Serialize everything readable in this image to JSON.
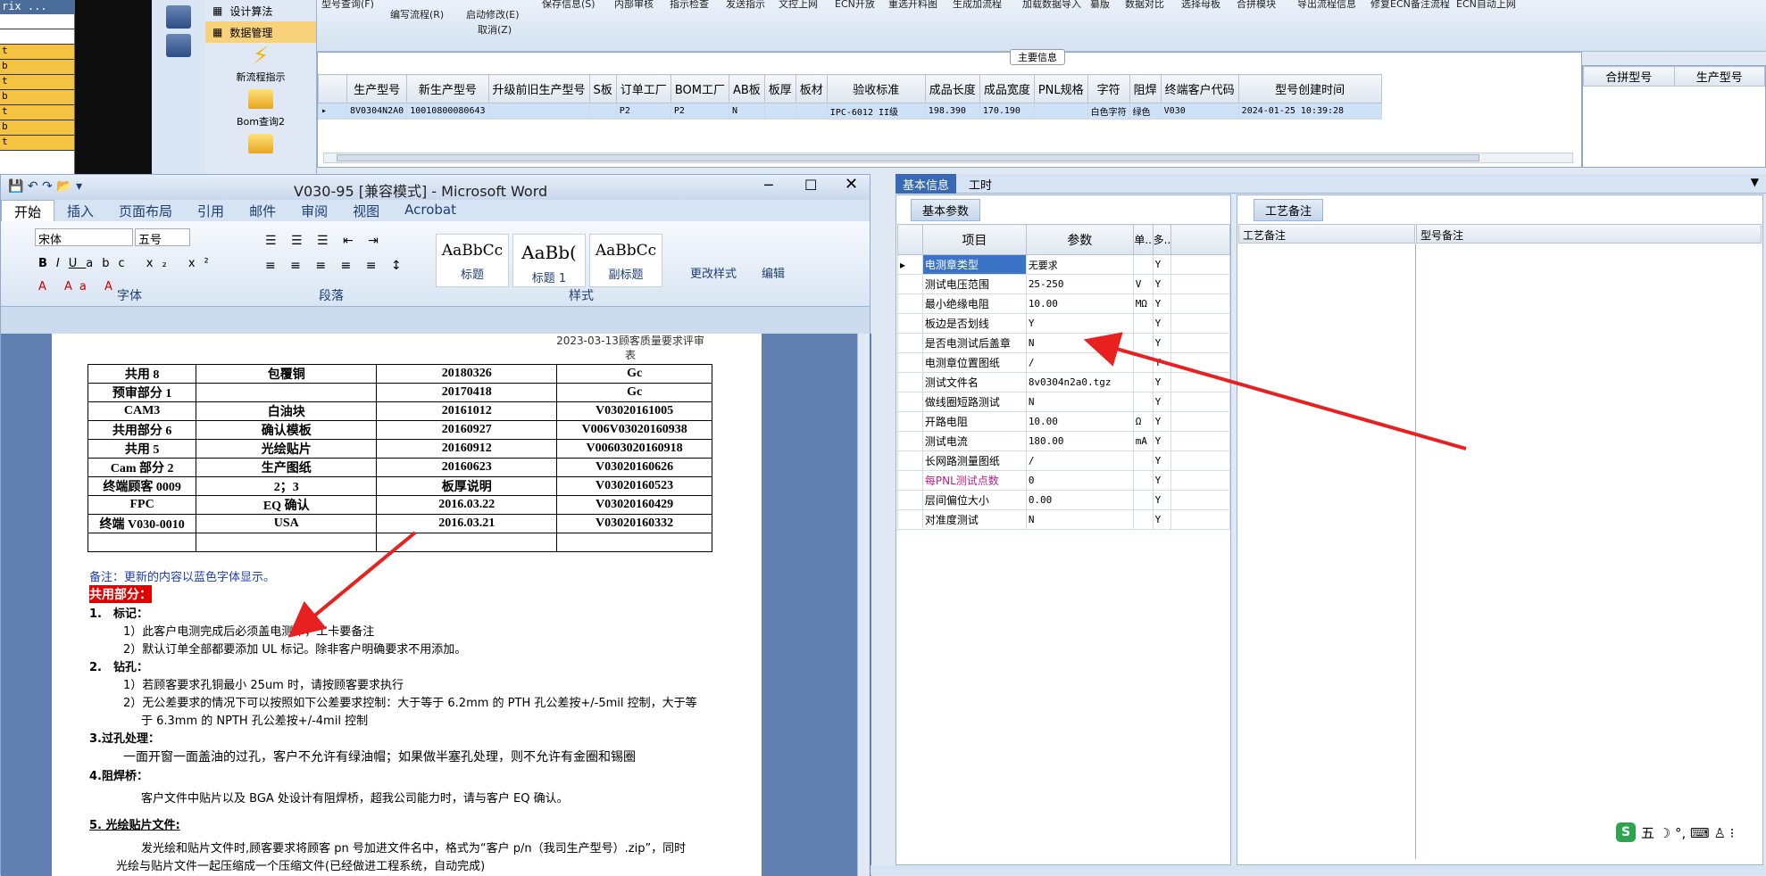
{
  "left_list": {
    "header": "rix ...",
    "rows": [
      "t",
      "b",
      "t",
      "b",
      "t",
      "b",
      "t"
    ]
  },
  "nav": {
    "menu": [
      {
        "label": "设计算法",
        "selected": false
      },
      {
        "label": "数据管理",
        "selected": true
      }
    ],
    "buttons": [
      {
        "label": "新流程指示"
      },
      {
        "label": "Bom查询2"
      }
    ]
  },
  "toolbar": {
    "items": [
      "型号查询(F)",
      "编写流程(R)",
      "启动修改(E)",
      "取消(Z)",
      "保存信息(S)",
      "内部审核",
      "指示检查",
      "发送指示",
      "文控上网",
      "ECN开放",
      "重选开料图",
      "生成加流程",
      "加载数据导入",
      "纂版",
      "数据对比",
      "选择母板",
      "合拼模块",
      "导出流程信息",
      "修复ECN备注流程",
      "ECN自动上网"
    ]
  },
  "main": {
    "section": "主要信息",
    "columns": [
      "生产型号",
      "新生产型号",
      "升级前旧生产型号",
      "S板",
      "订单工厂",
      "BOM工厂",
      "AB板",
      "板厚",
      "板材",
      "验收标准",
      "成品长度",
      "成品宽度",
      "PNL规格",
      "字符",
      "阻焊",
      "终端客户代码",
      "型号创建时间"
    ],
    "row": [
      "8V0304N2A0",
      "10010800080643",
      "",
      "",
      "P2",
      "P2",
      "N",
      "",
      "",
      "IPC-6012 II级",
      "198.390",
      "170.190",
      "",
      "白色字符",
      "绿色",
      "V030",
      "2024-01-25 10:39:28"
    ]
  },
  "merge": {
    "columns": [
      "合拼型号",
      "生产型号"
    ]
  },
  "word": {
    "title": "V030-95 [兼容模式] - Microsoft Word",
    "tabs": [
      "开始",
      "插入",
      "页面布局",
      "引用",
      "邮件",
      "审阅",
      "视图",
      "Acrobat"
    ],
    "font_name": "宋体",
    "font_size": "五号",
    "groups": {
      "font": "字体",
      "paragraph": "段落",
      "styles": "样式"
    },
    "styles": [
      {
        "sample": "AaBbCc",
        "label": "标题"
      },
      {
        "sample": "AaBb(",
        "label": "标题 1"
      },
      {
        "sample": "AaBbCc",
        "label": "副标题"
      }
    ],
    "change_styles": "更改样式",
    "edit": "编辑",
    "table_top_note": "2023-03-13顾客质量要求评审表",
    "table": [
      [
        "共用 8",
        "包覆铜",
        "20180326",
        "Gc"
      ],
      [
        "预审部分 1",
        "",
        "20170418",
        "Gc"
      ],
      [
        "CAM3",
        "白油块",
        "20161012",
        "V03020161005"
      ],
      [
        "共用部分 6",
        "确认模板",
        "20160927",
        "V006V03020160938"
      ],
      [
        "共用 5",
        "光绘贴片",
        "20160912",
        "V00603020160918"
      ],
      [
        "Cam 部分 2",
        "生产图纸",
        "20160623",
        "V03020160626"
      ],
      [
        "终端顾客 0009",
        "2；3",
        "板厚说明",
        "V03020160523"
      ],
      [
        "FPC",
        "EQ 确认",
        "2016.03.22",
        "V03020160429"
      ],
      [
        "终端 V030-0010",
        "USA",
        "2016.03.21",
        "V03020160332"
      ]
    ],
    "note": "备注：更新的内容以蓝色字体显示。",
    "common": "共用部分：",
    "p1": "1.　标记：",
    "p1a": "1）此客户电测完成后必须盖电测印，工卡要备注",
    "p1b": "2）默认订单全部都要添加 UL 标记。除非客户明确要求不用添加。",
    "p2": "2.　钻孔：",
    "p2a": "1）若顾客要求孔铜最小 25um 时，请按顾客要求执行",
    "p2b": "2）无公差要求的情况下可以按照如下公差要求控制：大于等于 6.2mm 的 PTH 孔公差按+/-5mil 控制，大于等",
    "p2c": "于 6.3mm 的 NPTH 孔公差按+/-4mil 控制",
    "p3": "3.过孔处理：",
    "p3a": "一面开窗一面盖油的过孔，客户不允许有绿油帽；如果做半塞孔处理，则不允许有金圈和锡圈",
    "p4": "4.阻焊桥：",
    "p4a": "客户文件中贴片以及 BGA 处设计有阻焊桥，超我公司能力时，请与客户 EQ 确认。",
    "p5": "5. 光绘贴片文件:",
    "p5a": "发光绘和贴片文件时,顾客要求将顾客 pn 号加进文件名中，格式为“客户 p/n（我司生产型号）.zip”，同时",
    "p5b": "光绘与贴片文件一起压缩成一个压缩文件(已经做进工程系统，自动完成)"
  },
  "right": {
    "tabs": [
      "基本信息",
      "工时"
    ],
    "basic_tab": "基本参数",
    "columns": [
      "项目",
      "参数",
      "单..",
      "多.."
    ],
    "params": [
      [
        "电测章类型",
        "无要求",
        "",
        "Y"
      ],
      [
        "测试电压范围",
        "25-250",
        "V",
        "Y"
      ],
      [
        "最小绝缘电阻",
        "10.00",
        "MΩ",
        "Y"
      ],
      [
        "板边是否划线",
        "Y",
        "",
        "Y"
      ],
      [
        "是否电测试后盖章",
        "N",
        "",
        "Y"
      ],
      [
        "电测章位置图纸",
        "/",
        "",
        "Y"
      ],
      [
        "测试文件名",
        "8v0304n2a0.tgz",
        "",
        "Y"
      ],
      [
        "做线圈短路测试",
        "N",
        "",
        "Y"
      ],
      [
        "开路电阻",
        "10.00",
        "Ω",
        "Y"
      ],
      [
        "测试电流",
        "180.00",
        "mA",
        "Y"
      ],
      [
        "长网路测量图纸",
        "/",
        "",
        "Y"
      ],
      [
        "每PNL测试点数",
        "0",
        "",
        "Y"
      ],
      [
        "层间偏位大小",
        "0.00",
        "",
        "Y"
      ],
      [
        "对准度测试",
        "N",
        "",
        "Y"
      ]
    ],
    "craft_tab": "工艺备注",
    "craft_columns": [
      "工艺备注",
      "型号备注"
    ]
  },
  "ime": {
    "logo": "S",
    "text": "五 ☽ °, ⌨ ♙ ⁝"
  },
  "colors": {
    "accent": "#3869b4",
    "arrow": "#e82020",
    "selected_row": "#cfe1f7",
    "highlight": "#f5c342"
  }
}
